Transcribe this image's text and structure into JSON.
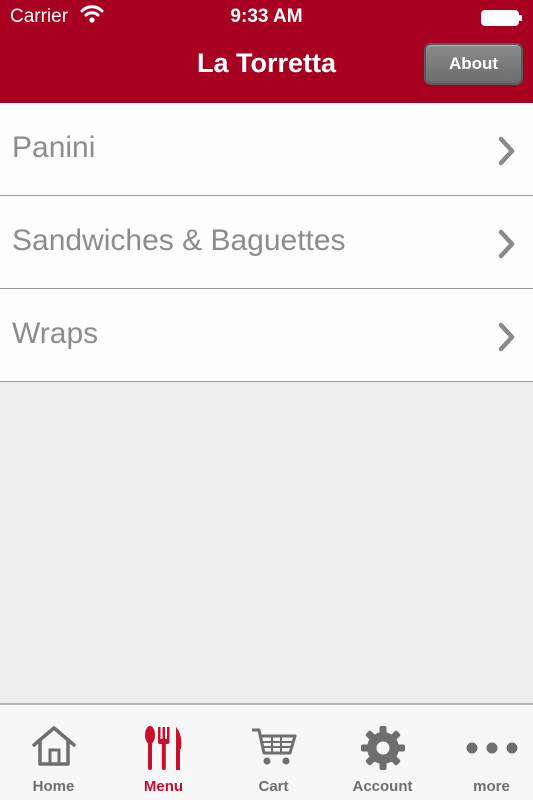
{
  "status_bar": {
    "carrier": "Carrier",
    "time": "9:33 AM"
  },
  "nav": {
    "title": "La Torretta",
    "about_label": "About"
  },
  "menu_items": [
    {
      "label": "Panini"
    },
    {
      "label": "Sandwiches & Baguettes"
    },
    {
      "label": "Wraps"
    }
  ],
  "tabs": [
    {
      "label": "Home",
      "icon": "home-icon"
    },
    {
      "label": "Menu",
      "icon": "utensils-icon",
      "active": true
    },
    {
      "label": "Cart",
      "icon": "cart-icon"
    },
    {
      "label": "Account",
      "icon": "gear-icon"
    },
    {
      "label": "more",
      "icon": "more-dots-icon"
    }
  ],
  "colors": {
    "brand_red": "#a80020",
    "active_tab": "#c8102e",
    "inactive_tab": "#6e6e6e"
  }
}
